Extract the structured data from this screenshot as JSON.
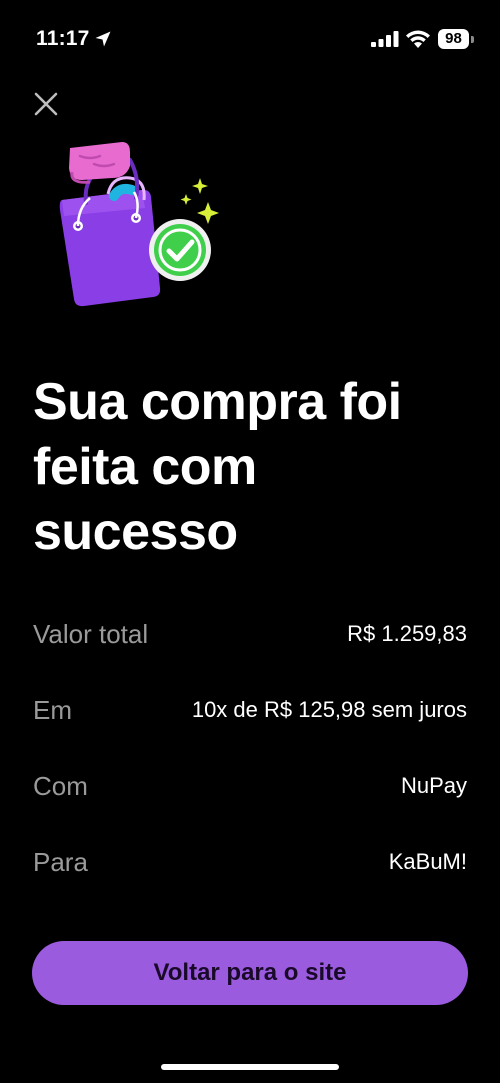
{
  "status_bar": {
    "time": "11:17",
    "battery": "98",
    "icons": [
      "location-arrow-icon",
      "cellular-signal-icon",
      "wifi-icon",
      "battery-icon"
    ]
  },
  "header": {
    "close_icon": "close-icon"
  },
  "illustration": {
    "icon": "shopping-bag-success-icon",
    "colors": {
      "bag": "#8a3ee6",
      "hand": "#e86bd0",
      "check_circle": "#3fcf4a",
      "sparkle": "#d8ef3a"
    }
  },
  "main": {
    "title": "Sua compra foi feita com sucesso"
  },
  "details": [
    {
      "label": "Valor total",
      "value": "R$ 1.259,83"
    },
    {
      "label": "Em",
      "value": "10x de R$ 125,98 sem juros"
    },
    {
      "label": "Com",
      "value": "NuPay"
    },
    {
      "label": "Para",
      "value": "KaBuM!"
    }
  ],
  "footer": {
    "button_label": "Voltar para o site"
  },
  "colors": {
    "background": "#000000",
    "accent": "#9b5bdf",
    "label": "#9a9a9a",
    "text": "#ffffff"
  }
}
